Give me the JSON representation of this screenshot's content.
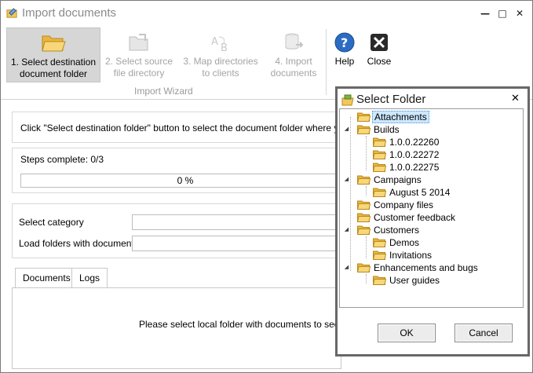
{
  "window": {
    "title": "Import documents",
    "minimize": "—",
    "restore": "□",
    "close": "✕"
  },
  "ribbon": {
    "steps": [
      {
        "line1": "1. Select destination",
        "line2": "document folder",
        "icon": "folder-open-icon"
      },
      {
        "line1": "2. Select source",
        "line2": "file directory",
        "icon": "folder-source-icon"
      },
      {
        "line1": "3. Map directories",
        "line2": "to clients",
        "icon": "map-ab-icon"
      },
      {
        "line1": "4. Import",
        "line2": "documents",
        "icon": "database-import-icon"
      }
    ],
    "group_label": "Import Wizard",
    "help_label": "Help",
    "close_label": "Close"
  },
  "main": {
    "instruction": "Click \"Select destination folder\" button to select the document folder where you want",
    "steps_complete": "Steps complete: 0/3",
    "progress_text": "0 %",
    "progress_value": 0,
    "select_category_label": "Select category",
    "load_folders_label": "Load folders with documents",
    "tabs": [
      "Documents",
      "Logs"
    ],
    "tab_message": "Please select local folder with documents to see the"
  },
  "dialog": {
    "title": "Select Folder",
    "close": "✕",
    "tree": [
      {
        "label": "Attachments",
        "level": 0,
        "expander": "",
        "selected": true
      },
      {
        "label": "Builds",
        "level": 0,
        "expander": "◢",
        "selected": false
      },
      {
        "label": "1.0.0.22260",
        "level": 1,
        "expander": "",
        "selected": false
      },
      {
        "label": "1.0.0.22272",
        "level": 1,
        "expander": "",
        "selected": false
      },
      {
        "label": "1.0.0.22275",
        "level": 1,
        "expander": "",
        "selected": false
      },
      {
        "label": "Campaigns",
        "level": 0,
        "expander": "◢",
        "selected": false
      },
      {
        "label": "August 5 2014",
        "level": 1,
        "expander": "",
        "selected": false
      },
      {
        "label": "Company files",
        "level": 0,
        "expander": "",
        "selected": false
      },
      {
        "label": "Customer feedback",
        "level": 0,
        "expander": "",
        "selected": false
      },
      {
        "label": "Customers",
        "level": 0,
        "expander": "◢",
        "selected": false
      },
      {
        "label": "Demos",
        "level": 1,
        "expander": "",
        "selected": false
      },
      {
        "label": "Invitations",
        "level": 1,
        "expander": "",
        "selected": false
      },
      {
        "label": "Enhancements and bugs",
        "level": 0,
        "expander": "◢",
        "selected": false
      },
      {
        "label": "User guides",
        "level": 1,
        "expander": "",
        "selected": false
      }
    ],
    "ok_label": "OK",
    "cancel_label": "Cancel"
  },
  "colors": {
    "folder": "#f2c75c",
    "selection": "#cde8ff",
    "ribbon_active": "#d6d6d6",
    "disabled_text": "#a4a4a4",
    "help_icon": "#2b6cc4"
  }
}
